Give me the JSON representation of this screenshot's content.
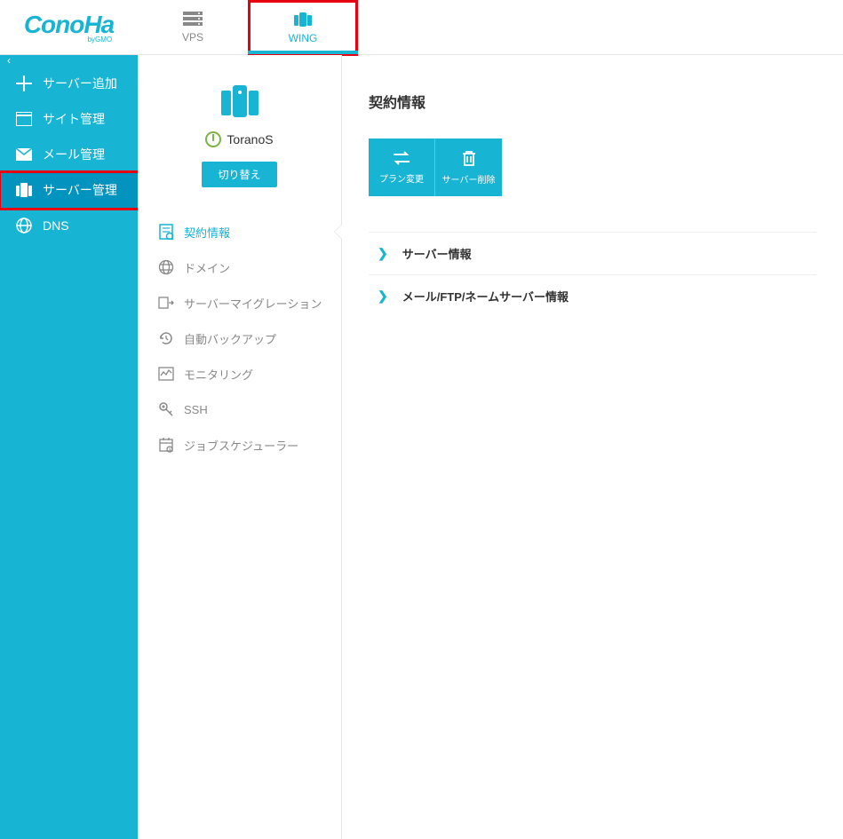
{
  "brand": {
    "name": "ConoHa",
    "sub": "byGMO"
  },
  "header_tabs": [
    {
      "label": "VPS",
      "active": false
    },
    {
      "label": "WING",
      "active": true,
      "highlighted": true
    }
  ],
  "sidebar": {
    "items": [
      {
        "label": "サーバー追加",
        "icon": "plus"
      },
      {
        "label": "サイト管理",
        "icon": "window"
      },
      {
        "label": "メール管理",
        "icon": "mail"
      },
      {
        "label": "サーバー管理",
        "icon": "server",
        "active": true,
        "highlighted": true
      },
      {
        "label": "DNS",
        "icon": "globe"
      }
    ]
  },
  "server_card": {
    "name": "ToranoS",
    "switch_label": "切り替え"
  },
  "sub_menu": [
    {
      "label": "契約情報",
      "icon": "contract",
      "active": true
    },
    {
      "label": "ドメイン",
      "icon": "globe2"
    },
    {
      "label": "サーバーマイグレーション",
      "icon": "migrate"
    },
    {
      "label": "自動バックアップ",
      "icon": "backup"
    },
    {
      "label": "モニタリング",
      "icon": "monitor"
    },
    {
      "label": "SSH",
      "icon": "key"
    },
    {
      "label": "ジョブスケジューラー",
      "icon": "schedule"
    }
  ],
  "content": {
    "title": "契約情報",
    "actions": [
      {
        "label": "プラン変更",
        "icon": "swap"
      },
      {
        "label": "サーバー削除",
        "icon": "trash"
      }
    ],
    "accordion": [
      {
        "label": "サーバー情報"
      },
      {
        "label": "メール/FTP/ネームサーバー情報"
      }
    ]
  }
}
